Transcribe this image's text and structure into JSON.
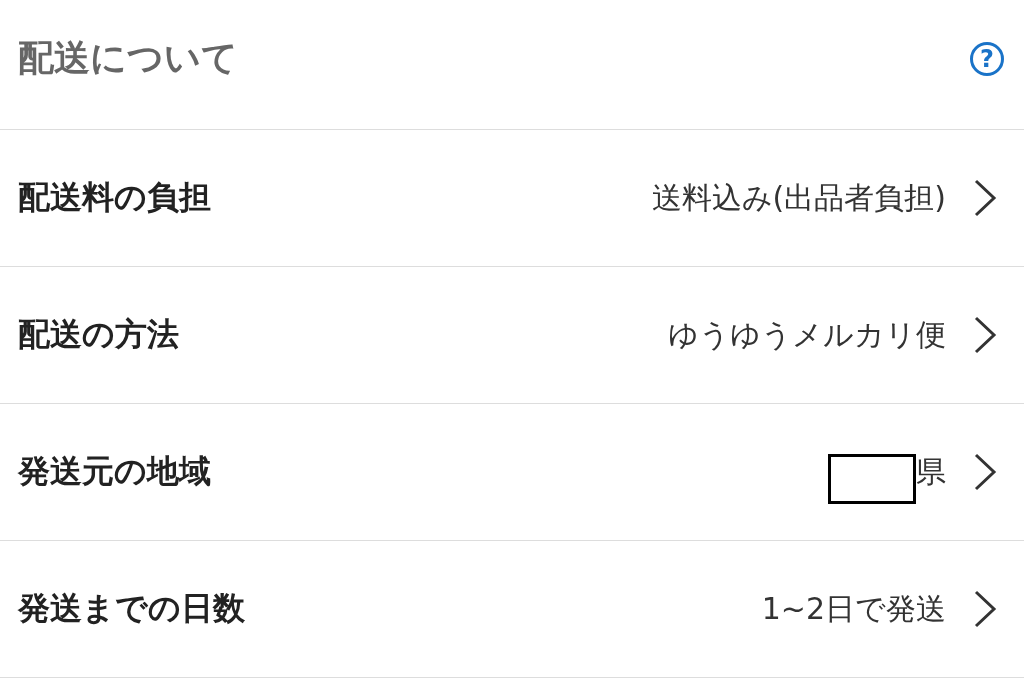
{
  "section": {
    "title": "配送について",
    "help_symbol": "?"
  },
  "rows": [
    {
      "label": "配送料の負担",
      "value": "送料込み(出品者負担)",
      "redacted": false
    },
    {
      "label": "配送の方法",
      "value": "ゆうゆうメルカリ便",
      "redacted": false
    },
    {
      "label": "発送元の地域",
      "value": "県",
      "redacted": true
    },
    {
      "label": "発送までの日数",
      "value": "1~2日で発送",
      "redacted": false
    }
  ]
}
